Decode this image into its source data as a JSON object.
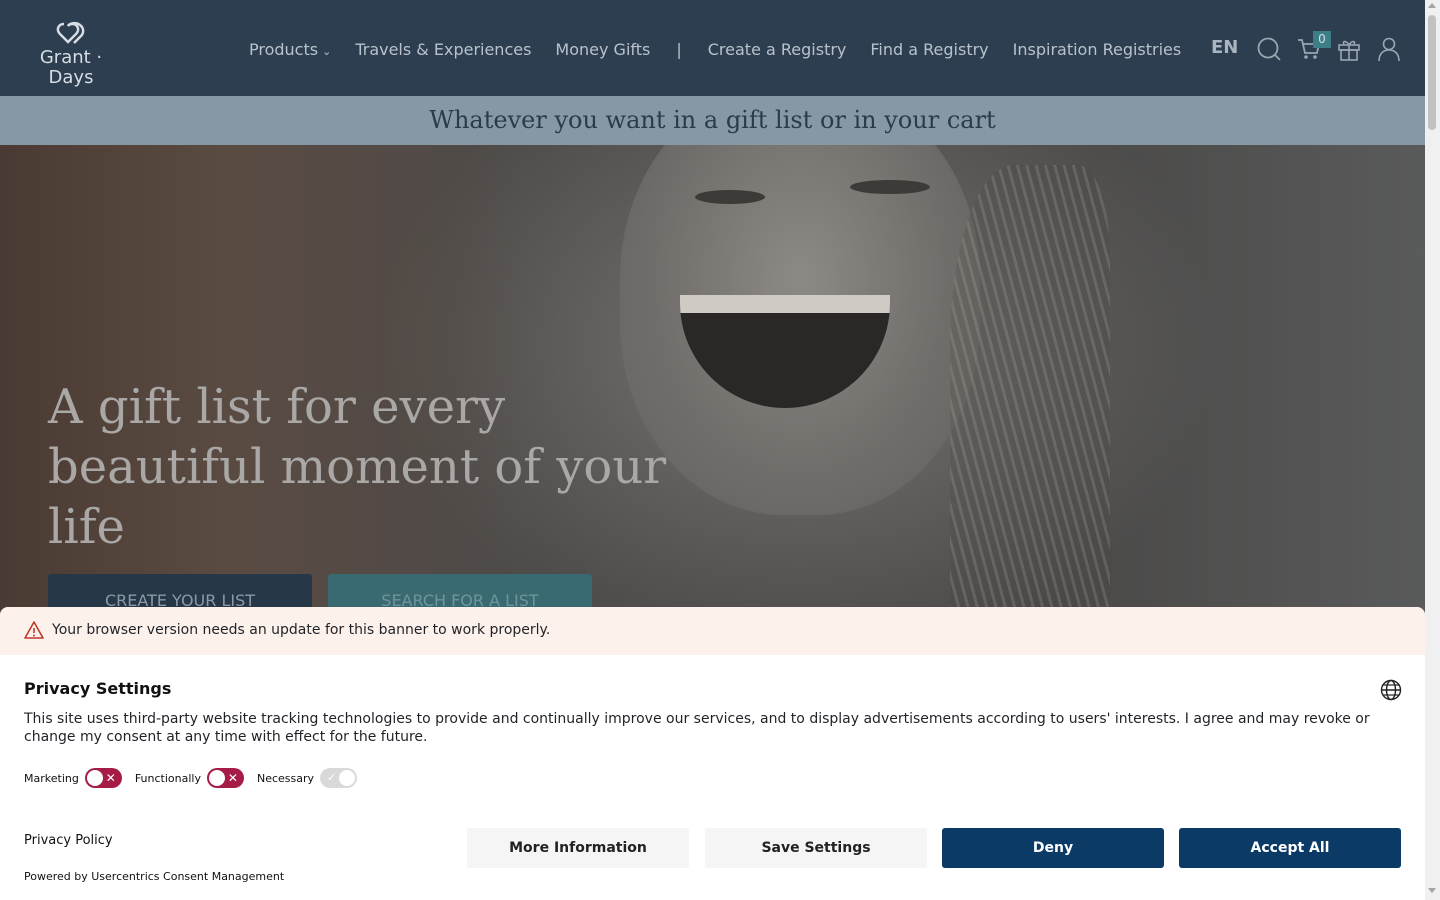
{
  "brand": {
    "name": "Grant · Days",
    "icon": "double-heart-logo"
  },
  "nav": {
    "items": [
      "Products",
      "Travels & Experiences",
      "Money Gifts"
    ],
    "separator": "|",
    "items_right": [
      "Create a Registry",
      "Find a Registry",
      "Inspiration Registries"
    ]
  },
  "header": {
    "language": "EN",
    "cart_count": "0",
    "icons": [
      "search-icon",
      "cart-icon",
      "gift-icon",
      "user-icon"
    ]
  },
  "tagline": "Whatever you want in a gift list or in your cart",
  "hero": {
    "title": "A gift list for every beautiful moment of your life",
    "create_button": "CREATE YOUR LIST",
    "search_button": "SEARCH FOR A LIST"
  },
  "consent": {
    "warning": "Your browser version needs an update for this banner to work properly.",
    "title": "Privacy Settings",
    "description": "This site uses third-party website tracking technologies to provide and continually improve our services, and to display advertisements according to users' interests. I agree and may revoke or change my consent at any time with effect for the future.",
    "toggles": [
      {
        "label": "Marketing",
        "state": "off"
      },
      {
        "label": "Functionally",
        "state": "off"
      },
      {
        "label": "Necessary",
        "state": "on-locked"
      }
    ],
    "privacy_policy": "Privacy Policy",
    "powered_by": "Powered by Usercentrics Consent Management",
    "buttons": {
      "more_info": "More Information",
      "save": "Save Settings",
      "deny": "Deny",
      "accept": "Accept All"
    }
  },
  "colors": {
    "header_bg": "#2c3e50",
    "tagline_bg": "#8797a4",
    "toggle_off": "#a51c46",
    "primary_button": "#0c3a66"
  }
}
